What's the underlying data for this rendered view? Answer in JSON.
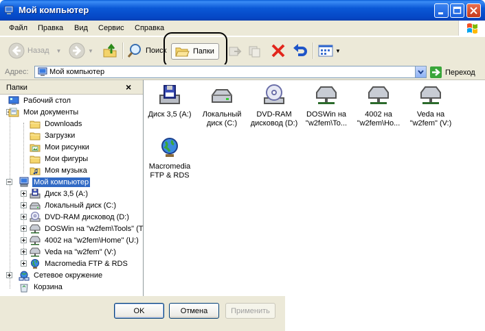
{
  "window": {
    "title": "Мой компьютер"
  },
  "menu": [
    "Файл",
    "Правка",
    "Вид",
    "Сервис",
    "Справка"
  ],
  "toolbar": {
    "back": "Назад",
    "search": "Поиск",
    "folders": "Папки"
  },
  "address": {
    "label": "Адрес:",
    "value": "Мой компьютер",
    "go": "Переход"
  },
  "folders_pane": {
    "title": "Папки",
    "close": "×",
    "tree": [
      {
        "label": "Рабочий стол",
        "icon": "desktop-icon"
      },
      {
        "label": "Мои документы",
        "icon": "my-documents-icon"
      },
      {
        "label": "Downloads",
        "icon": "folder-icon"
      },
      {
        "label": "Загрузки",
        "icon": "folder-icon"
      },
      {
        "label": "Мои рисунки",
        "icon": "pictures-folder-icon"
      },
      {
        "label": "Мои фигуры",
        "icon": "folder-icon"
      },
      {
        "label": "Моя музыка",
        "icon": "music-folder-icon"
      },
      {
        "label": "Мой компьютер",
        "icon": "computer-icon",
        "selected": true
      },
      {
        "label": "Диск 3,5 (A:)",
        "icon": "floppy-drive-icon"
      },
      {
        "label": "Локальный диск (C:)",
        "icon": "hard-drive-icon"
      },
      {
        "label": "DVD-RAM дисковод (D:)",
        "icon": "dvd-drive-icon"
      },
      {
        "label": "DOSWin на \"w2fem\\Tools\" (T",
        "icon": "network-drive-icon"
      },
      {
        "label": "4002 на \"w2fem\\Home\" (U:)",
        "icon": "network-drive-icon"
      },
      {
        "label": "Veda на \"w2fem\" (V:)",
        "icon": "network-drive-icon"
      },
      {
        "label": "Macromedia FTP & RDS",
        "icon": "globe-icon"
      },
      {
        "label": "Сетевое окружение",
        "icon": "network-places-icon"
      },
      {
        "label": "Корзина",
        "icon": "recycle-bin-icon"
      }
    ]
  },
  "items": [
    {
      "line1": "Диск 3,5 (A:)",
      "line2": "",
      "icon": "floppy-drive-icon"
    },
    {
      "line1": "Локальный",
      "line2": "диск (C:)",
      "icon": "hard-drive-icon"
    },
    {
      "line1": "DVD-RAM",
      "line2": "дисковод (D:)",
      "icon": "dvd-drive-icon"
    },
    {
      "line1": "DOSWin на",
      "line2": "\"w2fem\\To...",
      "icon": "network-drive-icon"
    },
    {
      "line1": "4002 на",
      "line2": "\"w2fem\\Ho...",
      "icon": "network-drive-icon"
    },
    {
      "line1": "Veda на",
      "line2": "\"w2fem\" (V:)",
      "icon": "network-drive-icon"
    },
    {
      "line1": "Macromedia",
      "line2": "FTP & RDS",
      "icon": "globe-icon"
    }
  ],
  "dialog": {
    "ok": "OK",
    "cancel": "Отмена",
    "apply": "Применить"
  },
  "colors": {
    "titlebar": "#0a58d6",
    "selection": "#316ac5",
    "chrome": "#ece9d8"
  }
}
